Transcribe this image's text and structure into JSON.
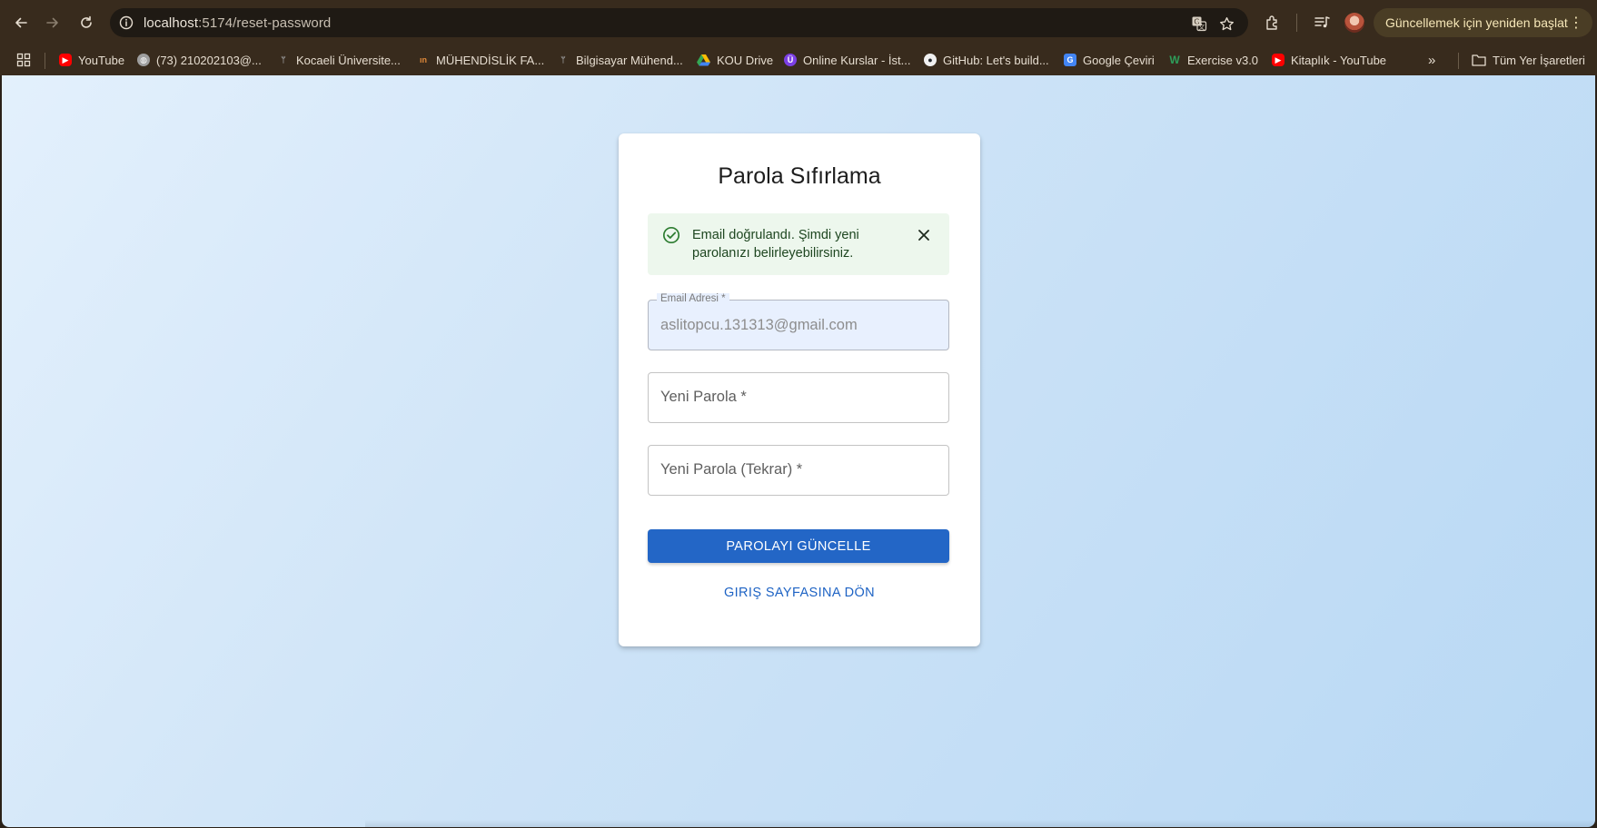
{
  "browser": {
    "url_host": "localhost",
    "url_path": ":5174/reset-password",
    "update_button_label": "Güncellemek için yeniden başlat",
    "bookmarks": [
      {
        "label": "YouTube",
        "icon": "youtube-icon",
        "color": "#ff0000"
      },
      {
        "label": "(73) 210202103@...",
        "icon": "globe-icon",
        "color": "#9e9e9e"
      },
      {
        "label": "Kocaeli Üniversite...",
        "icon": "kou-icon",
        "color": "#8a8a8a"
      },
      {
        "label": "MÜHENDİSLİK FA...",
        "icon": "faculty-icon",
        "color": "#e0893a"
      },
      {
        "label": "Bilgisayar Mühend...",
        "icon": "kou-icon",
        "color": "#8a8a8a"
      },
      {
        "label": "KOU Drive",
        "icon": "drive-icon",
        "color": "#34a853"
      },
      {
        "label": "Online Kurslar - İst...",
        "icon": "udemy-icon",
        "color": "#7b3fe4"
      },
      {
        "label": "GitHub: Let's build...",
        "icon": "github-icon",
        "color": "#f0f0f0"
      },
      {
        "label": "Google Çeviri",
        "icon": "translate-icon",
        "color": "#4285f4"
      },
      {
        "label": "Exercise v3.0",
        "icon": "exercise-icon",
        "color": "#2e9d5a"
      },
      {
        "label": "Kitaplık - YouTube",
        "icon": "youtube-icon",
        "color": "#ff0000"
      }
    ],
    "all_bookmarks_label": "Tüm Yer İşaretleri"
  },
  "page": {
    "title": "Parola Sıfırlama",
    "alert": {
      "message": "Email doğrulandı. Şimdi yeni parolanızı belirleyebilirsiniz.",
      "color": "#2e7d32"
    },
    "email_field": {
      "label": "Email Adresi *",
      "value": "aslitopcu.131313@gmail.com"
    },
    "new_password_field": {
      "label": "Yeni Parola *"
    },
    "confirm_password_field": {
      "label": "Yeni Parola (Tekrar) *"
    },
    "submit_button": "PAROLAYI GÜNCELLE",
    "back_link": "GIRIŞ SAYFASINA DÖN",
    "primary_color": "#2366c6"
  }
}
